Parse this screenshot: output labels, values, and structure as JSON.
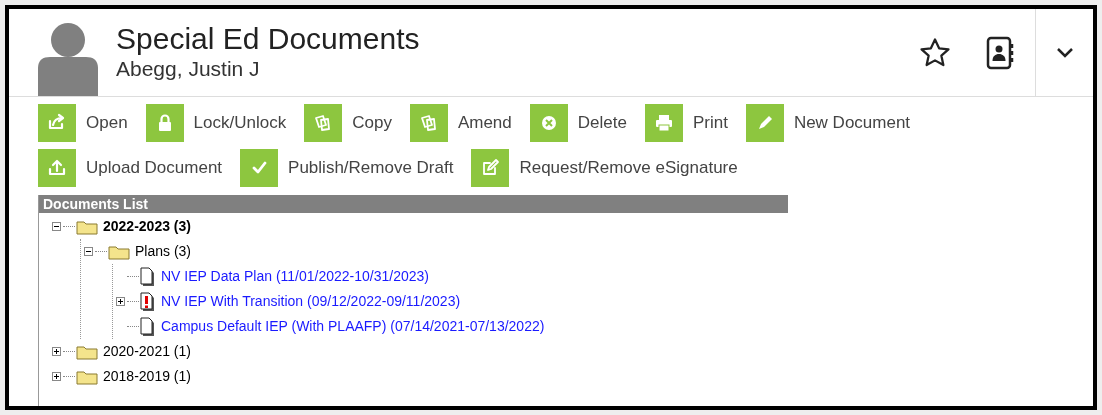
{
  "header": {
    "title": "Special Ed Documents",
    "student": "Abegg, Justin J"
  },
  "toolbar": [
    [
      {
        "label": "Open",
        "kind": "open"
      },
      {
        "label": "Lock/Unlock",
        "kind": "lock"
      },
      {
        "label": "Copy",
        "kind": "copy"
      },
      {
        "label": "Amend",
        "kind": "copy"
      },
      {
        "label": "Delete",
        "kind": "delete"
      },
      {
        "label": "Print",
        "kind": "print"
      },
      {
        "label": "New Document",
        "kind": "pencil"
      }
    ],
    [
      {
        "label": "Upload Document",
        "kind": "upload"
      },
      {
        "label": "Publish/Remove Draft",
        "kind": "check"
      },
      {
        "label": "Request/Remove eSignature",
        "kind": "edit"
      }
    ]
  ],
  "documents_list": {
    "title": "Documents List",
    "tree": [
      {
        "kind": "folder",
        "label": "2022-2023 (3)",
        "selected": true,
        "expanded": true,
        "children": [
          {
            "kind": "folder",
            "label": "Plans (3)",
            "selected": false,
            "expanded": true,
            "children": [
              {
                "kind": "document",
                "label": "NV IEP Data Plan (11/01/2022-10/31/2023)",
                "selected": false
              },
              {
                "kind": "alert-document",
                "label": "NV IEP With Transition (09/12/2022-09/11/2023)",
                "selected": false,
                "expanded": false
              },
              {
                "kind": "document",
                "label": "Campus Default IEP (With PLAAFP) (07/14/2021-07/13/2022)",
                "selected": false
              }
            ]
          }
        ]
      },
      {
        "kind": "folder",
        "label": "2020-2021 (1)",
        "selected": false,
        "expanded": false
      },
      {
        "kind": "folder",
        "label": "2018-2019 (1)",
        "selected": false,
        "expanded": false
      }
    ]
  }
}
